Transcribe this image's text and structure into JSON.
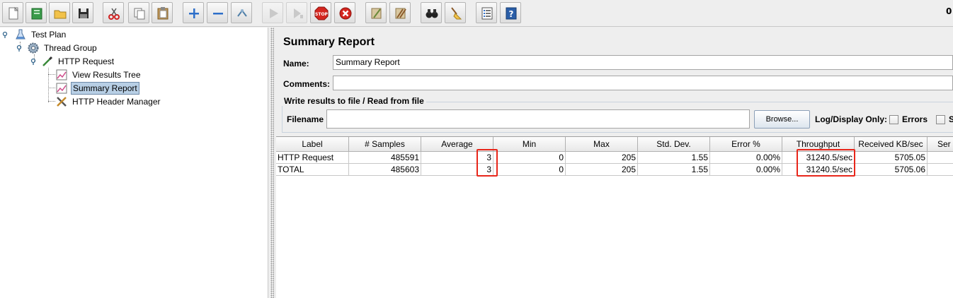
{
  "toolbar": {
    "counter": "0",
    "buttons": [
      "new-icon",
      "templates-icon",
      "open-icon",
      "save-icon",
      "cut-icon",
      "copy-icon",
      "paste-icon",
      "expand-icon",
      "collapse-icon",
      "toggle-icon",
      "start-icon",
      "start-no-pause-icon",
      "stop-icon",
      "shutdown-icon",
      "clear-icon",
      "clear-all-icon",
      "search-icon",
      "reset-search-icon",
      "function-helper-icon",
      "help-icon"
    ]
  },
  "tree": {
    "items": [
      {
        "label": "Test Plan",
        "icon": "flask-icon"
      },
      {
        "label": "Thread Group",
        "icon": "gear-icon"
      },
      {
        "label": "HTTP Request",
        "icon": "pipette-icon"
      },
      {
        "label": "View Results Tree",
        "icon": "graph-icon"
      },
      {
        "label": "Summary Report",
        "icon": "graph-icon",
        "selected": true
      },
      {
        "label": "HTTP Header Manager",
        "icon": "tools-icon"
      }
    ]
  },
  "panel": {
    "title": "Summary Report",
    "name_label": "Name:",
    "name_value": "Summary Report",
    "comments_label": "Comments:",
    "comments_value": "",
    "group_title": "Write results to file / Read from file",
    "filename_label": "Filename",
    "filename_value": "",
    "browse_label": "Browse...",
    "log_display_label": "Log/Display Only:",
    "errors_label": "Errors",
    "successes_label": "S"
  },
  "table": {
    "headers": [
      "Label",
      "# Samples",
      "Average",
      "Min",
      "Max",
      "Std. Dev.",
      "Error %",
      "Throughput",
      "Received KB/sec",
      "Ser"
    ],
    "rows": [
      [
        "HTTP Request",
        "485591",
        "3",
        "0",
        "205",
        "1.55",
        "0.00%",
        "31240.5/sec",
        "5705.05",
        ""
      ],
      [
        "TOTAL",
        "485603",
        "3",
        "0",
        "205",
        "1.55",
        "0.00%",
        "31240.5/sec",
        "5705.06",
        ""
      ]
    ]
  },
  "colors": {
    "highlight": "#e8261a",
    "selection": "#b8cfe5"
  }
}
